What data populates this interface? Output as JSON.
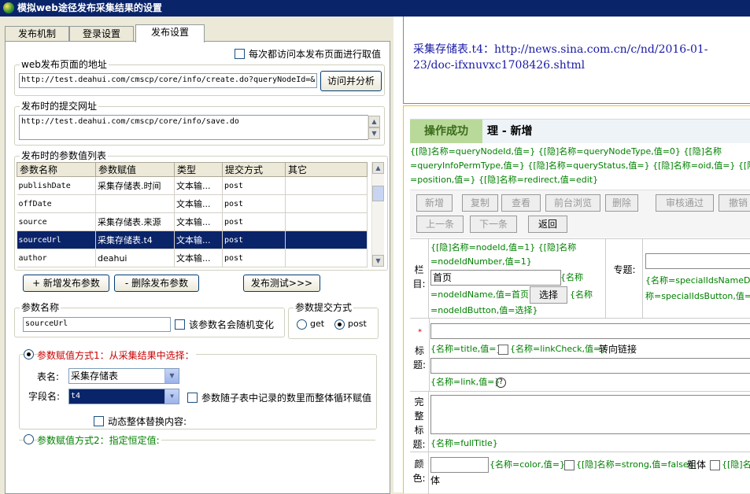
{
  "window": {
    "title": "模拟web途径发布采集结果的设置"
  },
  "tabs": [
    {
      "label": "发布机制"
    },
    {
      "label": "登录设置"
    },
    {
      "label": "发布设置"
    }
  ],
  "publish": {
    "revisit_label": "每次都访问本发布页面进行取值",
    "page_url_legend": "web发布页面的地址",
    "page_url_value": "http://test.deahui.com/cmscp/core/info/create.do?queryNodeId=&",
    "visit_analyze_button": "访问并分析",
    "submit_url_legend": "发布时的提交网址",
    "submit_url_value": "http://test.deahui.com/cmscp/core/info/save.do",
    "params_legend": "发布时的参数值列表",
    "columns": [
      "参数名称",
      "参数赋值",
      "类型",
      "提交方式",
      "其它"
    ],
    "rows": [
      {
        "name": "publishDate",
        "value": "采集存储表.时间",
        "type": "文本输...",
        "method": "post",
        "other": ""
      },
      {
        "name": "offDate",
        "value": "",
        "type": "文本输...",
        "method": "post",
        "other": ""
      },
      {
        "name": "source",
        "value": "采集存储表.来源",
        "type": "文本输...",
        "method": "post",
        "other": ""
      },
      {
        "name": "sourceUrl",
        "value": "采集存储表.t4",
        "type": "文本输...",
        "method": "post",
        "other": ""
      },
      {
        "name": "author",
        "value": "deahui",
        "type": "文本输...",
        "method": "post",
        "other": ""
      }
    ],
    "add_button": "+ 新增发布参数",
    "delete_button": "- 删除发布参数",
    "test_button": "发布测试>>>",
    "param_name_legend": "参数名称",
    "param_name_value": "sourceUrl",
    "random_label": "该参数名会随机变化",
    "submit_method_legend": "参数提交方式",
    "get_label": "get",
    "post_label": "post",
    "mode1_label": "参数赋值方式1：从采集结果中选择：",
    "table_label": "表名:",
    "table_value": "采集存储表",
    "field_label": "字段名:",
    "field_value": "t4",
    "loop_label": "参数随子表中记录的数里而整体循环赋值",
    "dynamic_label": "动态整体替换内容:",
    "mode2_label": "参数赋值方式2：指定恒定值:"
  },
  "preview": {
    "top_label": "采集存储表.t4：",
    "top_url": "http://news.sina.com.cn/c/nd/2016-01-23/doc-ifxnuvxc1708426.shtml",
    "success_label": "操作成功",
    "page_heading": "理 - 新增",
    "hidden_lines": [
      "{[隐]名称=queryNodeId,值=} {[隐]名称=queryNodeType,值=0} {[隐]名称",
      "=queryInfoPermType,值=} {[隐]名称=queryStatus,值=} {[隐]名称=oid,值=} {[隐]名称",
      "=position,值=} {[隐]名称=redirect,值=edit}"
    ],
    "toolbar": [
      "新增",
      "复制",
      "查看",
      "前台浏览",
      "删除",
      "审核通过",
      "撤销"
    ],
    "toolbar2": [
      "上一条",
      "下一条"
    ],
    "back_button": "返回",
    "column_label": "栏目:",
    "column_hidden_1": "{[隐]名称=nodeId,值=1} {[隐]名称",
    "column_hidden_2": "=nodeIdNumber,值=1}",
    "column_value": "首页",
    "column_name_tag_1": "{名称",
    "column_name_tag_2": "=nodeIdName,值=首页}",
    "select_button": "选择",
    "column_btn_tag_1": "{名称",
    "column_btn_tag_2": "=nodeIdButton,值=选择}",
    "topic_label": "专题:",
    "topic_tag_1": "{名称=specialIdsNameDisplay",
    "topic_tag_2": "称=specialIdsButton,值=",
    "required_mark": "*",
    "title_label": "标题:",
    "title_tag": "{名称=title,值=}",
    "linkcheck_tag": "{名称=linkCheck,值=}",
    "redirect_label": "转向链接",
    "link_tag": "{名称=link,值=}",
    "help_icon": "?",
    "fulltitle_label": "完整标题:",
    "fulltitle_tag": "{名称=fullTitle}",
    "color_label": "颜色:",
    "color_tag": "{名称=color,值=}",
    "strong_tag": "{[隐]名称=strong,值=false}",
    "bold_label": "粗体",
    "more_tag": "{[隐]名",
    "body_label": "体"
  }
}
